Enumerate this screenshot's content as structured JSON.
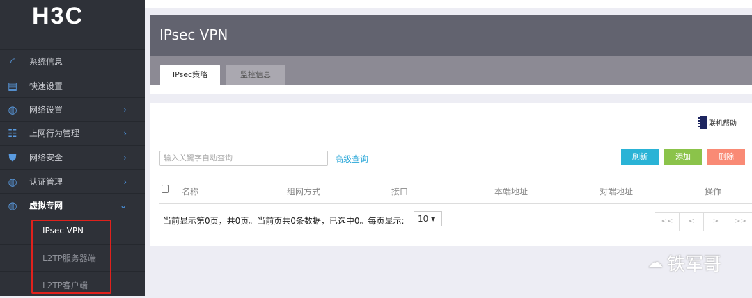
{
  "brand": "H3C",
  "sidebar": {
    "items": [
      {
        "label": "系统信息",
        "icon": "dashboard-icon",
        "chevron": ""
      },
      {
        "label": "快速设置",
        "icon": "document-edit-icon",
        "chevron": ""
      },
      {
        "label": "网络设置",
        "icon": "globe-icon",
        "chevron": "›"
      },
      {
        "label": "上网行为管理",
        "icon": "network-icon",
        "chevron": "›"
      },
      {
        "label": "网络安全",
        "icon": "shield-icon",
        "chevron": "›"
      },
      {
        "label": "认证管理",
        "icon": "globe-icon",
        "chevron": "›"
      },
      {
        "label": "虚拟专网",
        "icon": "globe-user-icon",
        "chevron": "⌄"
      }
    ],
    "subitems": [
      "IPsec VPN",
      "L2TP服务器端",
      "L2TP客户端"
    ]
  },
  "header": {
    "title": "IPsec VPN"
  },
  "tabs": [
    "IPsec策略",
    "监控信息"
  ],
  "help": "联机帮助",
  "search": {
    "placeholder": "输入关键字自动查询"
  },
  "advanced_query": "高级查询",
  "buttons": {
    "refresh": "刷新",
    "add": "添加",
    "delete": "删除"
  },
  "colors": {
    "refresh": "#2ab3d6",
    "add": "#8bc34a",
    "delete": "#f98a75"
  },
  "table": {
    "columns": [
      "名称",
      "组网方式",
      "接口",
      "本端地址",
      "对端地址",
      "操作"
    ]
  },
  "pagination": {
    "info": "当前显示第0页，共0页。当前页共0条数据，已选中0。每页显示:",
    "page_size": "10 ▾",
    "controls": [
      "<<",
      "<",
      ">",
      ">>"
    ]
  },
  "watermark": "铁军哥"
}
